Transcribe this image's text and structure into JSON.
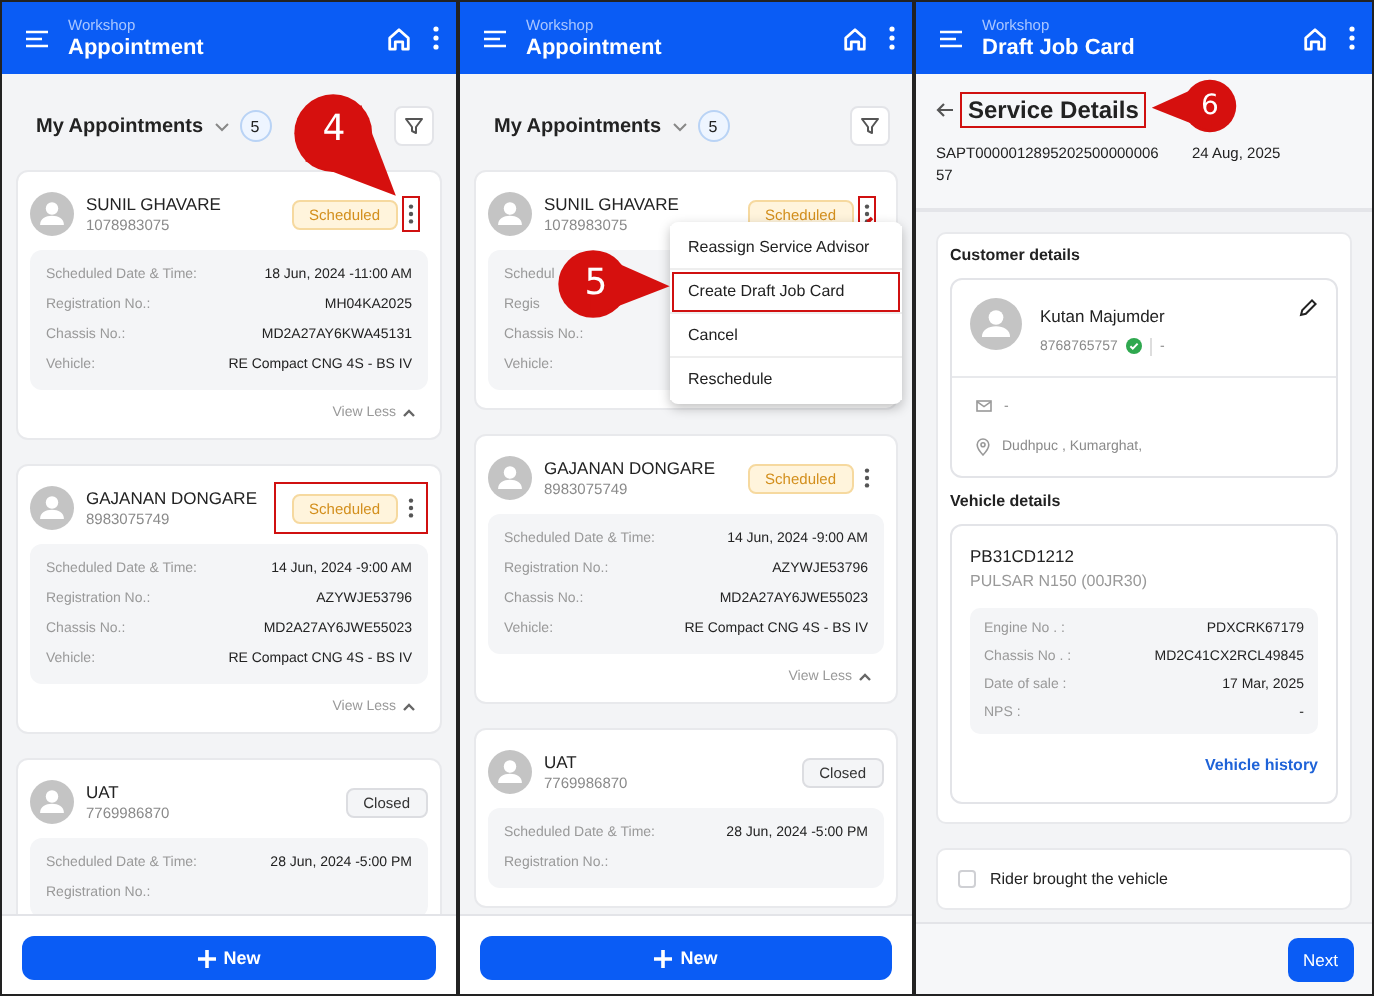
{
  "screens": [
    {
      "kind": "appointments",
      "header": {
        "section": "Workshop",
        "title": "Appointment"
      },
      "list_title": "My Appointments",
      "count": "5",
      "callout": {
        "number": "4"
      },
      "cards": [
        {
          "name": "SUNIL GHAVARE",
          "phone": "1078983075",
          "status": "Scheduled",
          "kind": "scheduled",
          "menu_highlighted": true,
          "status_highlighted": false,
          "details": [
            {
              "label": "Scheduled Date & Time:",
              "value": "18 Jun, 2024 -11:00 AM"
            },
            {
              "label": "Registration No.:",
              "value": "MH04KA2025"
            },
            {
              "label": "Chassis No.:",
              "value": "MD2A27AY6KWA45131"
            },
            {
              "label": "Vehicle:",
              "value": "RE Compact CNG 4S - BS IV"
            }
          ],
          "footer": "View Less"
        },
        {
          "name": "GAJANAN DONGARE",
          "phone": "8983075749",
          "status": "Scheduled",
          "kind": "scheduled",
          "menu_highlighted": false,
          "status_highlighted": true,
          "details": [
            {
              "label": "Scheduled Date & Time:",
              "value": "14 Jun, 2024 -9:00 AM"
            },
            {
              "label": "Registration No.:",
              "value": "AZYWJE53796"
            },
            {
              "label": "Chassis No.:",
              "value": "MD2A27AY6JWE55023"
            },
            {
              "label": "Vehicle:",
              "value": "RE Compact CNG 4S - BS IV"
            }
          ],
          "footer": "View Less"
        },
        {
          "name": "UAT",
          "phone": "7769986870",
          "status": "Closed",
          "kind": "closed",
          "details": [
            {
              "label": "Scheduled Date & Time:",
              "value": "28 Jun, 2024 -5:00 PM"
            },
            {
              "label": "Registration No.:"
            }
          ]
        }
      ],
      "new_button": "New"
    },
    {
      "kind": "appointments",
      "header": {
        "section": "Workshop",
        "title": "Appointment"
      },
      "list_title": "My Appointments",
      "count": "5",
      "callout": {
        "number": "5"
      },
      "cards": [
        {
          "name": "SUNIL GHAVARE",
          "phone": "1078983075",
          "status": "Scheduled",
          "kind": "scheduled",
          "menu_highlighted": true,
          "status_highlighted": false,
          "details": [
            {
              "label": "Schedul"
            },
            {
              "label": "Regis"
            },
            {
              "label": "Chassis No.:"
            },
            {
              "label": "Vehicle:"
            }
          ]
        },
        {
          "name": "GAJANAN DONGARE",
          "phone": "8983075749",
          "status": "Scheduled",
          "kind": "scheduled",
          "menu_highlighted": false,
          "status_highlighted": false,
          "details": [
            {
              "label": "Scheduled Date & Time:",
              "value": "14 Jun, 2024 -9:00 AM"
            },
            {
              "label": "Registration No.:",
              "value": "AZYWJE53796"
            },
            {
              "label": "Chassis No.:",
              "value": "MD2A27AY6JWE55023"
            },
            {
              "label": "Vehicle:",
              "value": "RE Compact CNG 4S - BS IV"
            }
          ],
          "footer": "View Less"
        },
        {
          "name": "UAT",
          "phone": "7769986870",
          "status": "Closed",
          "kind": "closed",
          "details": [
            {
              "label": "Scheduled Date & Time:",
              "value": "28 Jun, 2024 -5:00 PM"
            },
            {
              "label": "Registration No.:"
            }
          ]
        }
      ],
      "menu": {
        "items": [
          {
            "label": "Reassign Service Advisor",
            "highlighted": false
          },
          {
            "label": "Create Draft Job Card",
            "highlighted": true
          },
          {
            "label": "Cancel",
            "highlighted": false
          },
          {
            "label": "Reschedule",
            "highlighted": false
          }
        ]
      },
      "new_button": "New"
    },
    {
      "kind": "job_card",
      "header": {
        "section": "Workshop",
        "title": "Draft Job Card"
      },
      "title": "Service Details",
      "title_highlighted": true,
      "callout": {
        "number": "6"
      },
      "reference": "SAPT000001289520250000000657",
      "date": "24 Aug, 2025",
      "customer": {
        "heading": "Customer details",
        "name": "Kutan Majumder",
        "phone": "8768765757",
        "verified": true,
        "alt_phone": "-",
        "email": "-",
        "address": "Dudhpuc , Kumarghat,"
      },
      "vehicle": {
        "heading": "Vehicle details",
        "registration": "PB31CD1212",
        "model": "PULSAR N150 (00JR30)",
        "details": [
          {
            "label": "Engine No . :",
            "value": "PDXCRK67179"
          },
          {
            "label": "Chassis No . :",
            "value": "MD2C41CX2RCL49845"
          },
          {
            "label": "Date of sale :",
            "value": "17 Mar, 2025"
          },
          {
            "label": "NPS :",
            "value": "-"
          }
        ],
        "history_link": "Vehicle history"
      },
      "rider_checkbox": {
        "label": "Rider brought the vehicle",
        "checked": false
      },
      "next_button": "Next"
    }
  ]
}
